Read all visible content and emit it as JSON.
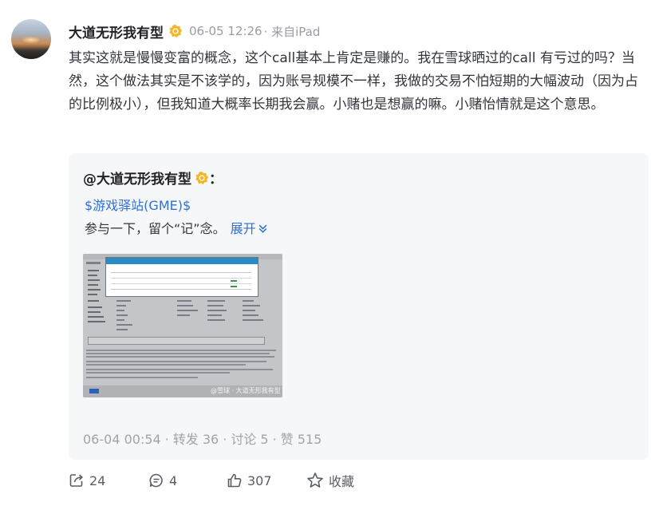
{
  "post": {
    "author": "大道无形我有型",
    "timestamp": "06-05 12:26",
    "source": "· 来自iPad",
    "text": "其实这就是慢慢变富的概念，这个call基本上肯定是赚的。我在雪球晒过的call 有亏过的吗？当然，这个做法其实是不该学的，因为账号规模不一样，我做的交易不怕短期的大幅波动（因为占的比例极小），但我知道大概率长期我会赢。小赌也是想赢的嘛。小赌怡情就是这个意思。"
  },
  "quote": {
    "author": "@大道无形我有型",
    "colon": "：",
    "stock_link": "$游戏驿站(GME)$",
    "text": "参与一下，留个“记”念。",
    "expand_label": "展开",
    "image_watermark": "@雪球 · 大道无形我有型",
    "meta_date": "06-04 00:54",
    "meta_repost": "转发 36",
    "meta_discuss": "讨论 5",
    "meta_like": "赞 515",
    "meta_sep": "·"
  },
  "actions": {
    "repost_count": "24",
    "comment_count": "4",
    "like_count": "307",
    "favorite_label": "收藏"
  },
  "icons": {
    "badge": "verified-badge-icon",
    "repost": "repost-icon",
    "comment": "comment-icon",
    "like": "thumbs-up-icon",
    "favorite": "star-icon"
  },
  "colors": {
    "link": "#2f6fd6",
    "badge": "#f5b52b",
    "meta": "#9a9ca3"
  }
}
